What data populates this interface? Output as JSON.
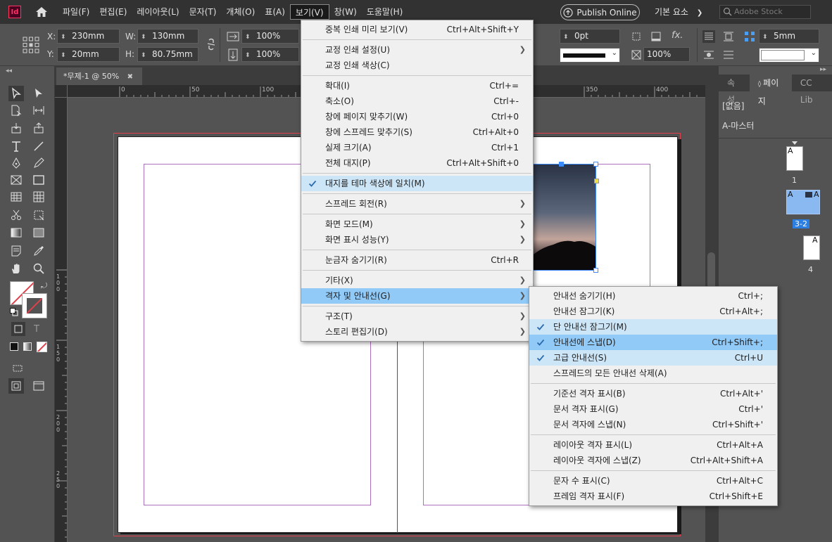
{
  "app": {
    "logo": "Id"
  },
  "menubar": {
    "items": [
      "파일(F)",
      "편집(E)",
      "레이아웃(L)",
      "문자(T)",
      "개체(O)",
      "표(A)",
      "보기(V)",
      "창(W)",
      "도움말(H)"
    ],
    "publish_label": "Publish Online",
    "workspace_label": "기본 요소",
    "stock_placeholder": "Adobe Stock"
  },
  "control": {
    "x_label": "X:",
    "x_value": "230mm",
    "y_label": "Y:",
    "y_value": "20mm",
    "w_label": "W:",
    "w_value": "130mm",
    "h_label": "H:",
    "h_value": "80.75mm",
    "scale_x": "100%",
    "scale_y": "100%",
    "stroke_weight": "0pt",
    "opacity": "100%",
    "gap_value": "5mm"
  },
  "document": {
    "tab_title": "*무제-1 @ 50%",
    "close_glyph": "✖",
    "hruler_ticks": [
      "0",
      "50",
      "100",
      "350",
      "400"
    ],
    "vruler_ticks": [
      "1 0 0",
      "1 5 0",
      "2 0 0",
      "2 5 0"
    ]
  },
  "pages_panel": {
    "tabs": [
      "속성",
      "페이지",
      "CC Lib"
    ],
    "none_label": "[없음]",
    "master_label": "A-마스터",
    "page_letter": "A",
    "page1_num": "1",
    "spread_num": "3-2",
    "page4_num": "4"
  },
  "view_menu": {
    "items": [
      {
        "label": "중복 인쇄 미리 보기(V)",
        "shortcut": "Ctrl+Alt+Shift+Y"
      },
      {
        "sep": true
      },
      {
        "label": "교정 인쇄 설정(U)",
        "submenu": true
      },
      {
        "label": "교정 인쇄 색상(C)"
      },
      {
        "sep": true
      },
      {
        "label": "확대(I)",
        "shortcut": "Ctrl+="
      },
      {
        "label": "축소(O)",
        "shortcut": "Ctrl+-"
      },
      {
        "label": "창에 페이지 맞추기(W)",
        "shortcut": "Ctrl+0"
      },
      {
        "label": "창에 스프레드 맞추기(S)",
        "shortcut": "Ctrl+Alt+0"
      },
      {
        "label": "실제 크기(A)",
        "shortcut": "Ctrl+1"
      },
      {
        "label": "전체 대지(P)",
        "shortcut": "Ctrl+Alt+Shift+0"
      },
      {
        "sep": true
      },
      {
        "label": "대지를 테마 색상에 일치(M)",
        "checked": true
      },
      {
        "sep": true
      },
      {
        "label": "스프레드 회전(R)",
        "submenu": true
      },
      {
        "sep": true
      },
      {
        "label": "화면 모드(M)",
        "submenu": true
      },
      {
        "label": "화면 표시 성능(Y)",
        "submenu": true
      },
      {
        "sep": true
      },
      {
        "label": "눈금자 숨기기(R)",
        "shortcut": "Ctrl+R"
      },
      {
        "sep": true
      },
      {
        "label": "기타(X)",
        "submenu": true
      },
      {
        "label": "격자 및 안내선(G)",
        "submenu": true,
        "highlighted": true
      },
      {
        "sep": true
      },
      {
        "label": "구조(T)",
        "submenu": true
      },
      {
        "label": "스토리 편집기(D)",
        "submenu": true
      }
    ]
  },
  "grid_submenu": {
    "items": [
      {
        "label": "안내선 숨기기(H)",
        "shortcut": "Ctrl+;"
      },
      {
        "label": "안내선 잠그기(K)",
        "shortcut": "Ctrl+Alt+;"
      },
      {
        "label": "단 안내선 잠그기(M)",
        "checked": true
      },
      {
        "label": "안내선에 스냅(D)",
        "shortcut": "Ctrl+Shift+;",
        "checked": true,
        "highlighted": true
      },
      {
        "label": "고급 안내선(S)",
        "shortcut": "Ctrl+U",
        "checked": true
      },
      {
        "label": "스프레드의 모든 안내선 삭제(A)"
      },
      {
        "sep": true
      },
      {
        "label": "기준선 격자 표시(B)",
        "shortcut": "Ctrl+Alt+'"
      },
      {
        "label": "문서 격자 표시(G)",
        "shortcut": "Ctrl+'"
      },
      {
        "label": "문서 격자에 스냅(N)",
        "shortcut": "Ctrl+Shift+'"
      },
      {
        "sep": true
      },
      {
        "label": "레이아웃 격자 표시(L)",
        "shortcut": "Ctrl+Alt+A"
      },
      {
        "label": "레이아웃 격자에 스냅(Z)",
        "shortcut": "Ctrl+Alt+Shift+A"
      },
      {
        "sep": true
      },
      {
        "label": "문자 수 표시(C)",
        "shortcut": "Ctrl+Alt+C"
      },
      {
        "label": "프레임 격자 표시(F)",
        "shortcut": "Ctrl+Shift+E"
      }
    ]
  },
  "colors": {
    "menubar_bg": "#323232",
    "panel_bg": "#535353",
    "menu_bg": "#f0f0f0",
    "highlight": "#91c9f7",
    "checked_bg": "#cde6f7",
    "check_color": "#2b6cb0",
    "bleed": "#e0414c",
    "margin": "#b070c0",
    "page_selected": "#8ab8f0"
  }
}
